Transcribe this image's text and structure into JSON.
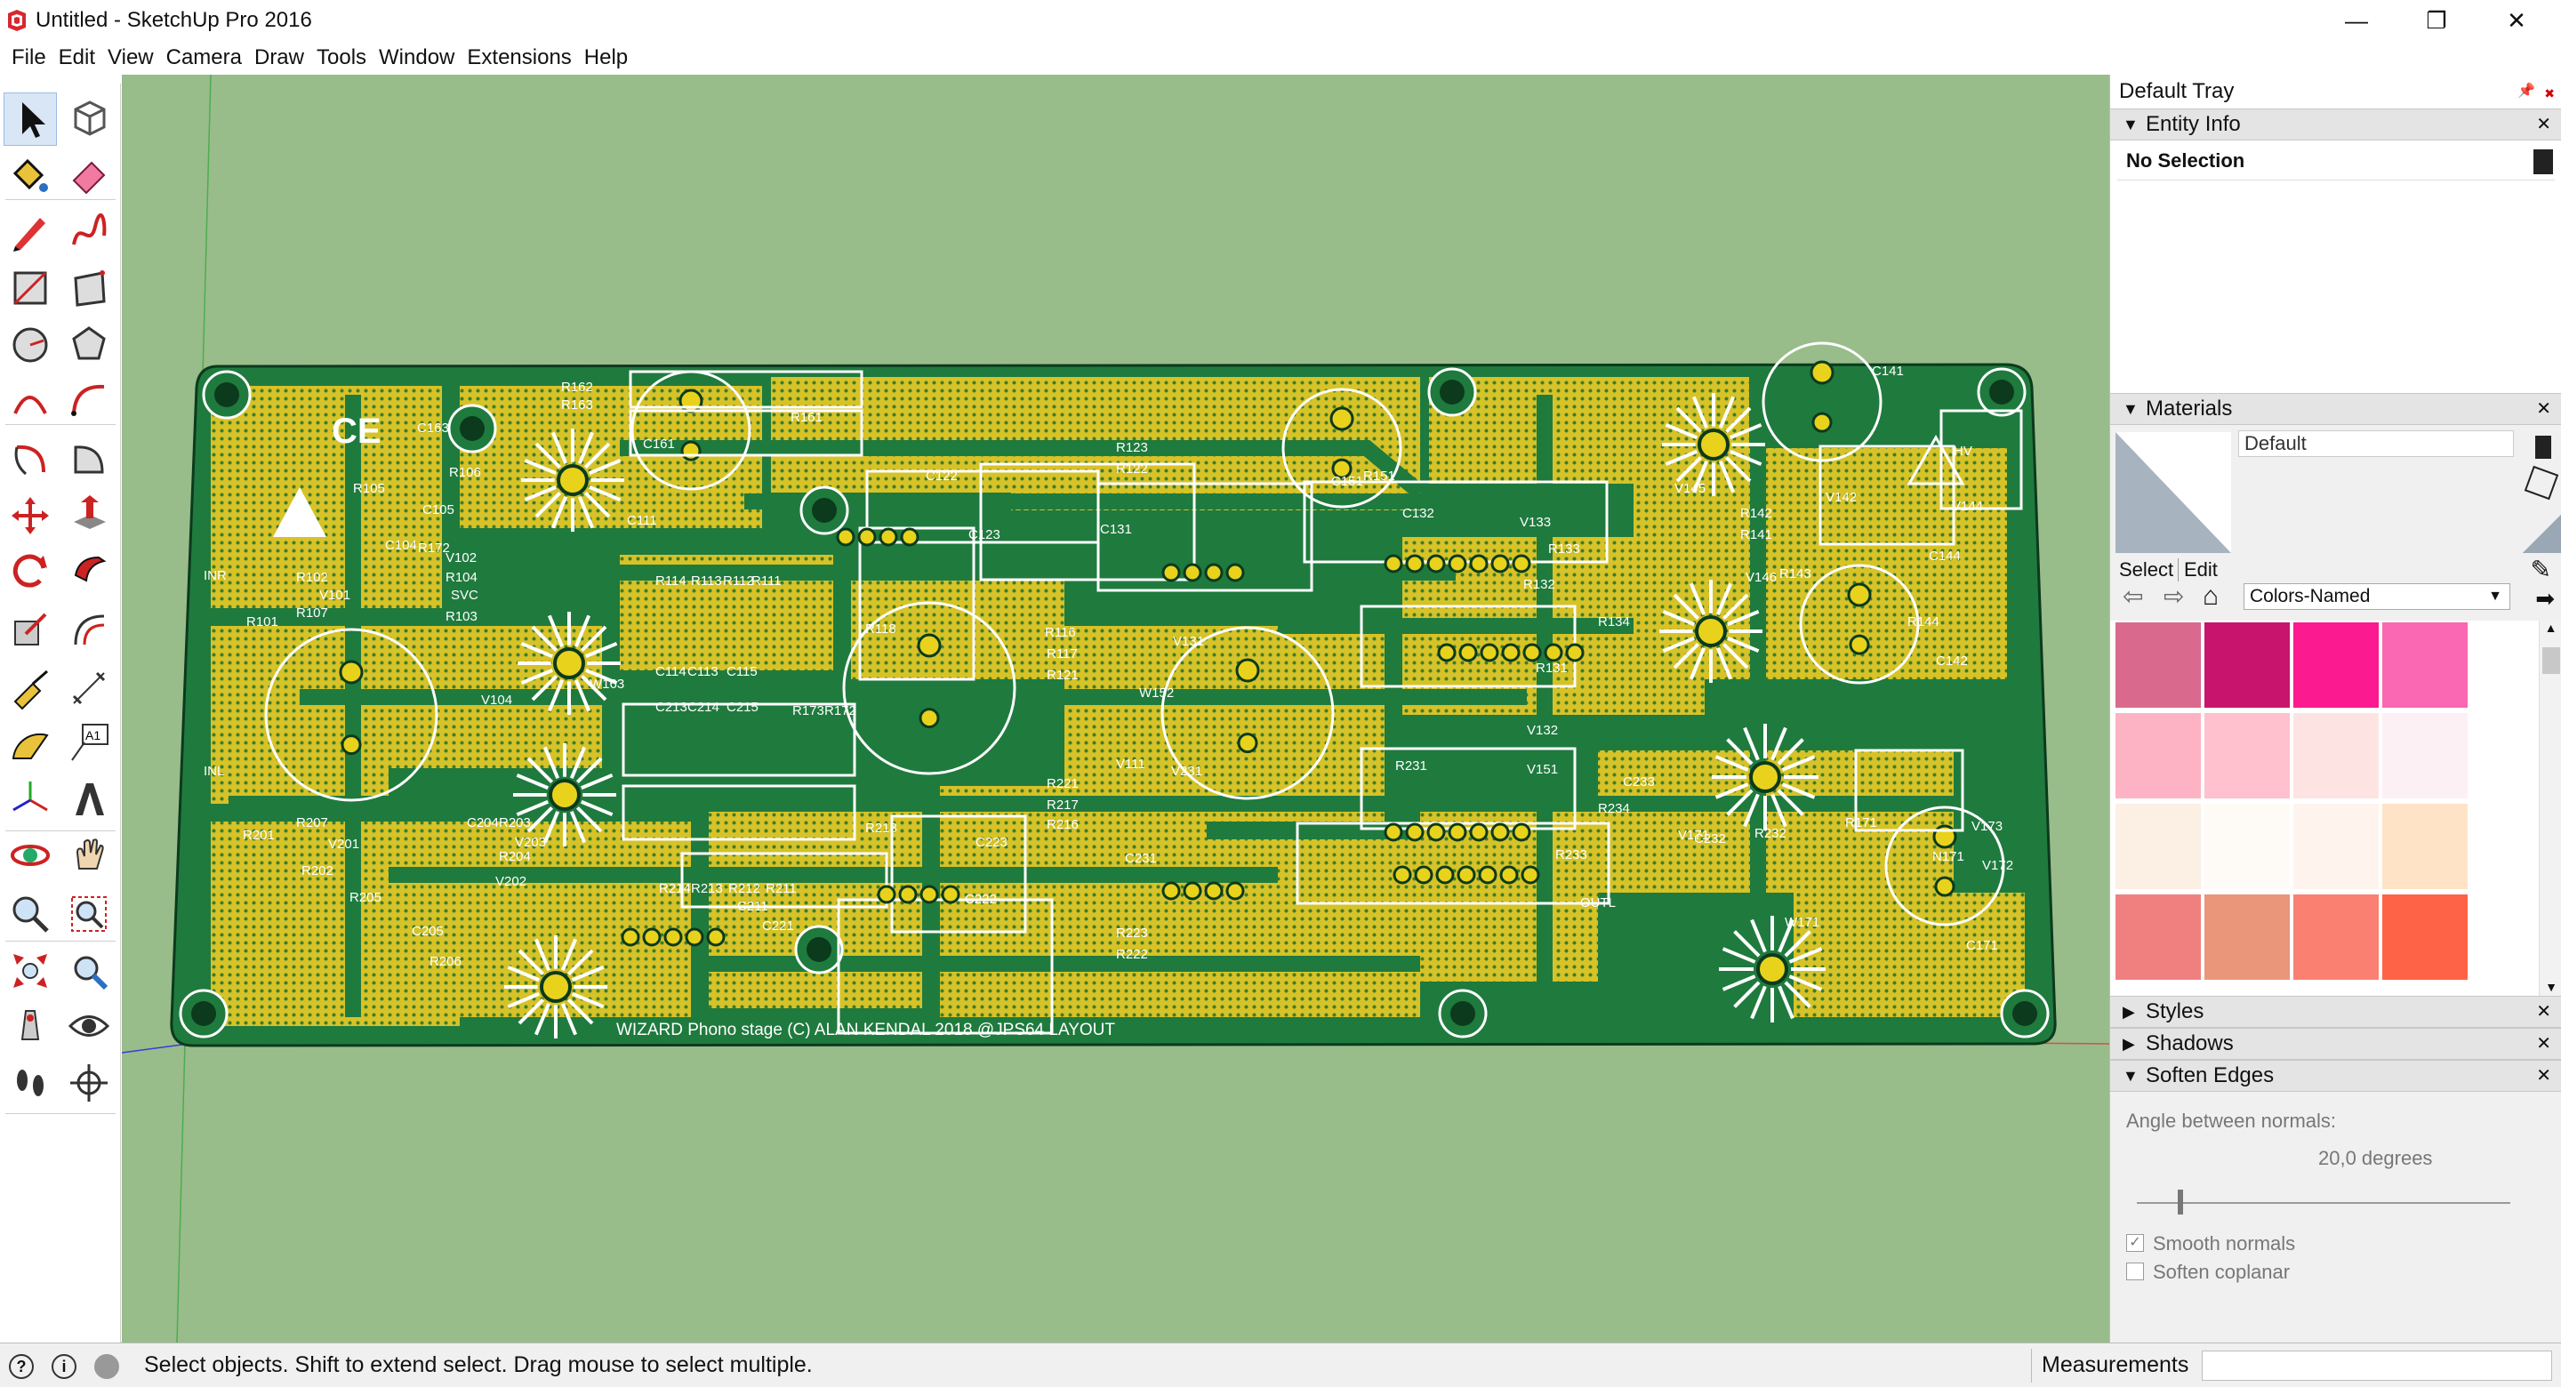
{
  "window": {
    "title": "Untitled - SketchUp Pro 2016",
    "minimize_glyph": "—",
    "maximize_glyph": "❐",
    "close_glyph": "✕"
  },
  "menu": [
    "File",
    "Edit",
    "View",
    "Camera",
    "Draw",
    "Tools",
    "Window",
    "Extensions",
    "Help"
  ],
  "tools": [
    {
      "name": "select-tool-icon",
      "active": true
    },
    {
      "name": "make-component-icon"
    },
    {
      "name": "paint-bucket-icon"
    },
    {
      "name": "eraser-icon"
    },
    {
      "name": "pencil-line-icon"
    },
    {
      "name": "freehand-icon"
    },
    {
      "name": "rectangle-icon"
    },
    {
      "name": "rotated-rectangle-icon"
    },
    {
      "name": "circle-icon"
    },
    {
      "name": "polygon-icon"
    },
    {
      "name": "arc-icon"
    },
    {
      "name": "two-point-arc-icon"
    },
    {
      "name": "three-point-arc-icon"
    },
    {
      "name": "pie-icon"
    },
    {
      "name": "move-icon"
    },
    {
      "name": "push-pull-icon"
    },
    {
      "name": "rotate-icon"
    },
    {
      "name": "follow-me-icon"
    },
    {
      "name": "scale-icon"
    },
    {
      "name": "offset-icon"
    },
    {
      "name": "tape-measure-icon"
    },
    {
      "name": "dimension-icon"
    },
    {
      "name": "protractor-icon"
    },
    {
      "name": "text-tool-icon",
      "label": "A1"
    },
    {
      "name": "axes-icon"
    },
    {
      "name": "3d-text-icon"
    },
    {
      "name": "orbit-icon"
    },
    {
      "name": "pan-icon"
    },
    {
      "name": "zoom-icon"
    },
    {
      "name": "zoom-window-icon"
    },
    {
      "name": "zoom-extents-icon"
    },
    {
      "name": "previous-view-icon"
    },
    {
      "name": "position-camera-icon"
    },
    {
      "name": "look-around-icon"
    },
    {
      "name": "walk-icon"
    },
    {
      "name": "section-plane-icon"
    }
  ],
  "pcb": {
    "footer_text": "WIZARD Phono stage (C) ALAN KENDAL 2018 @JPS64 LAYOUT",
    "labels": [
      "R162",
      "R163",
      "R161",
      "C163",
      "R106",
      "C105",
      "R105",
      "C104",
      "V102",
      "R104",
      "R102",
      "V101",
      "R107",
      "R103",
      "INR",
      "R101",
      "C161",
      "C111",
      "R114",
      "R113",
      "R112",
      "R111",
      "C114",
      "C113",
      "C115",
      "C213",
      "C214",
      "C215",
      "R173",
      "R172",
      "R123",
      "R122",
      "C122",
      "C123",
      "C131",
      "R116",
      "R117",
      "R121",
      "R118",
      "V131",
      "C151",
      "R151",
      "C132",
      "V133",
      "R133",
      "R131",
      "R132",
      "V132",
      "C141",
      "C142",
      "V145",
      "R142",
      "R141",
      "V142",
      "V144",
      "HV",
      "C144",
      "R143",
      "V146",
      "R144",
      "R134",
      "R231",
      "V151",
      "V111",
      "W152",
      "V231",
      "R221",
      "R217",
      "R216",
      "R218",
      "C231",
      "R223",
      "R222",
      "C221",
      "C223",
      "C222",
      "R214",
      "R213",
      "R212",
      "R211",
      "V203",
      "R203",
      "C204",
      "R204",
      "V202",
      "R205",
      "C205",
      "R206",
      "R207",
      "V201",
      "R202",
      "R201",
      "INL",
      "C211",
      "W163",
      "V104",
      "R233",
      "OUTL",
      "R234",
      "C233",
      "C232",
      "R232",
      "W171",
      "R171",
      "N171",
      "V173",
      "C171",
      "V171",
      "V172",
      "R172",
      "SVC"
    ]
  },
  "tray": {
    "title": "Default Tray",
    "entity_info": {
      "header": "Entity Info",
      "value": "No Selection"
    },
    "materials": {
      "header": "Materials",
      "material_name": "Default",
      "tab_select": "Select",
      "tab_edit": "Edit",
      "library": "Colors-Named",
      "swatches": [
        "#d96a8e",
        "#c9146e",
        "#fb1a8f",
        "#fa67b2",
        "#fdb3c3",
        "#fec1cd",
        "#fde4e2",
        "#fdf0f4",
        "#fcefe4",
        "#fefaf6",
        "#fef4ed",
        "#fee3c7",
        "#f08080",
        "#e9967a",
        "#fa8072",
        "#ff6347"
      ]
    },
    "styles": {
      "header": "Styles"
    },
    "shadows": {
      "header": "Shadows"
    },
    "soften": {
      "header": "Soften Edges",
      "angle_label": "Angle between normals:",
      "angle_value": "20,0  degrees",
      "slider_fraction": 0.11,
      "smooth_normals": "Smooth normals",
      "soften_coplanar": "Soften coplanar"
    }
  },
  "status": {
    "hint": "Select objects. Shift to extend select. Drag mouse to select multiple.",
    "measurements_label": "Measurements",
    "measurements_value": ""
  }
}
